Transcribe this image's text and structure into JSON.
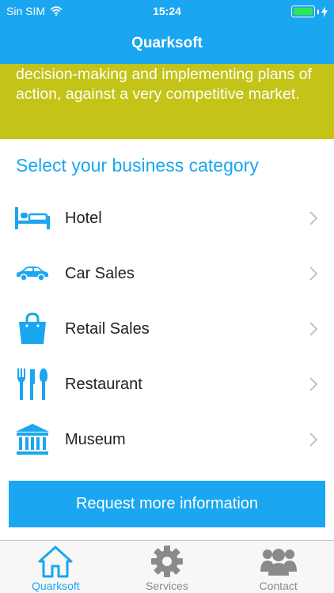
{
  "status_bar": {
    "carrier": "Sin SIM",
    "time": "15:24",
    "battery_level": 1.0
  },
  "header": {
    "title": "Quarksoft"
  },
  "intro": {
    "text": "providing relevant and timely information for decision-making and implementing plans of action, against a very competitive market."
  },
  "categories": {
    "heading": "Select your business category",
    "items": [
      {
        "label": "Hotel",
        "icon": "bed-icon"
      },
      {
        "label": "Car Sales",
        "icon": "car-icon"
      },
      {
        "label": "Retail Sales",
        "icon": "shopping-bag-icon"
      },
      {
        "label": "Restaurant",
        "icon": "fork-knife-icon"
      },
      {
        "label": "Museum",
        "icon": "museum-icon"
      }
    ]
  },
  "request_button": {
    "label": "Request more information"
  },
  "tabs": [
    {
      "label": "Quarksoft",
      "icon": "home-icon",
      "active": true
    },
    {
      "label": "Services",
      "icon": "gear-icon",
      "active": false
    },
    {
      "label": "Contact",
      "icon": "people-icon",
      "active": false
    }
  ],
  "colors": {
    "accent": "#1aa6f0",
    "banner": "#c3c417",
    "battery": "#2ee64f"
  }
}
